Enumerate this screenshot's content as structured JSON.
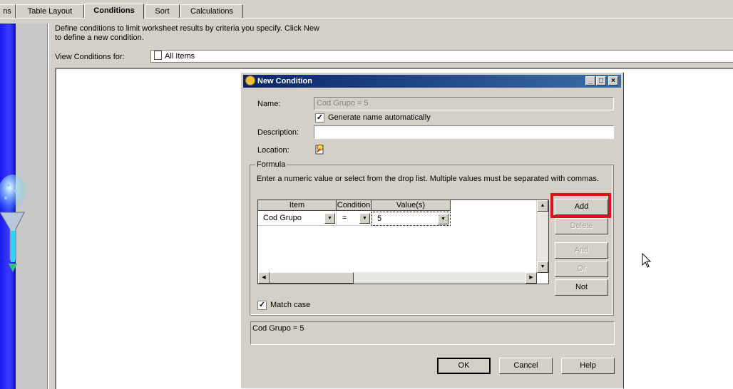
{
  "tabs": [
    {
      "label": "ns",
      "active": false
    },
    {
      "label": "Table Layout",
      "active": false
    },
    {
      "label": "Conditions",
      "active": true
    },
    {
      "label": "Sort",
      "active": false
    },
    {
      "label": "Calculations",
      "active": false
    }
  ],
  "main": {
    "description": "Define conditions to limit worksheet results by criteria you specify. Click New to define a new condition.",
    "view_conditions_label": "View Conditions for:",
    "view_conditions_value": "All Items"
  },
  "dialog": {
    "title": "New Condition",
    "name_label": "Name:",
    "name_value": "Cod Grupo = 5",
    "generate_name_label": "Generate name automatically",
    "generate_name_checked": true,
    "description_label": "Description:",
    "description_value": "",
    "location_label": "Location:",
    "formula_label": "Formula",
    "formula_hint": "Enter a numeric value or select from the drop list. Multiple values must be separated with commas.",
    "grid": {
      "headers": [
        "Item",
        "Condition",
        "Value(s)"
      ],
      "row": {
        "item": "Cod Grupo",
        "condition": "=",
        "value": "5"
      }
    },
    "buttons": {
      "add": "Add",
      "delete": "Delete",
      "and": "And",
      "or": "Or",
      "not": "Not"
    },
    "match_case_label": "Match case",
    "match_case_checked": true,
    "preview_text": "Cod Grupo = 5",
    "ok": "OK",
    "cancel": "Cancel",
    "help": "Help"
  },
  "colors": {
    "highlight": "#e0101a",
    "titlebar": "#0a246a",
    "side_panel": "#1a1af0"
  }
}
